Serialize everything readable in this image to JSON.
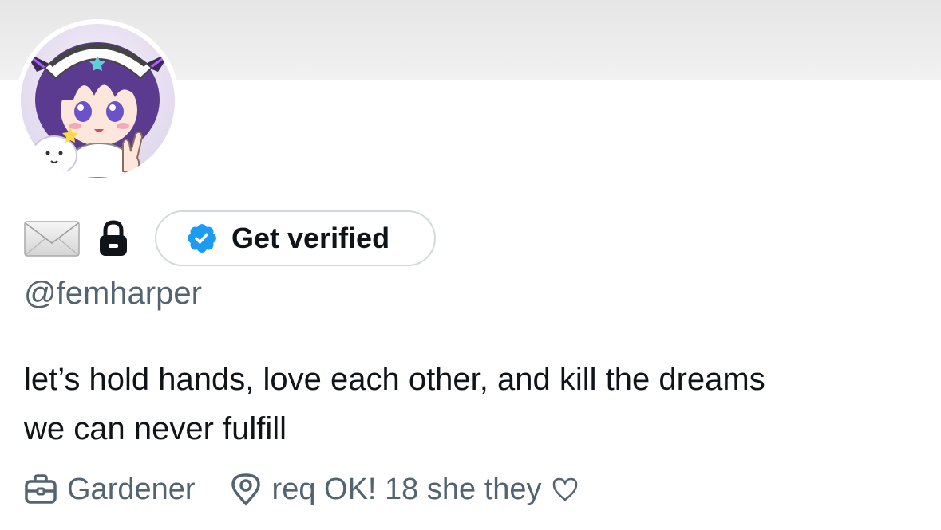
{
  "profile": {
    "get_verified_label": "Get verified",
    "handle": "@femharper",
    "bio_line1": "let’s hold hands, love each other, and kill the dreams",
    "bio_line2": "we can never fulfill",
    "profession": "Gardener",
    "location": "req OK! 18 she they"
  },
  "icons": {
    "envelope": "envelope-emoji-icon",
    "lock": "lock-emoji-icon",
    "badge": "verified-badge-icon",
    "briefcase": "briefcase-icon",
    "location": "location-pin-icon",
    "heart": "heart-outline-icon"
  },
  "colors": {
    "verified_blue": "#1d9bf0",
    "secondary_text": "#536471",
    "primary_text": "#0f1419",
    "button_border": "#cfd9de"
  }
}
